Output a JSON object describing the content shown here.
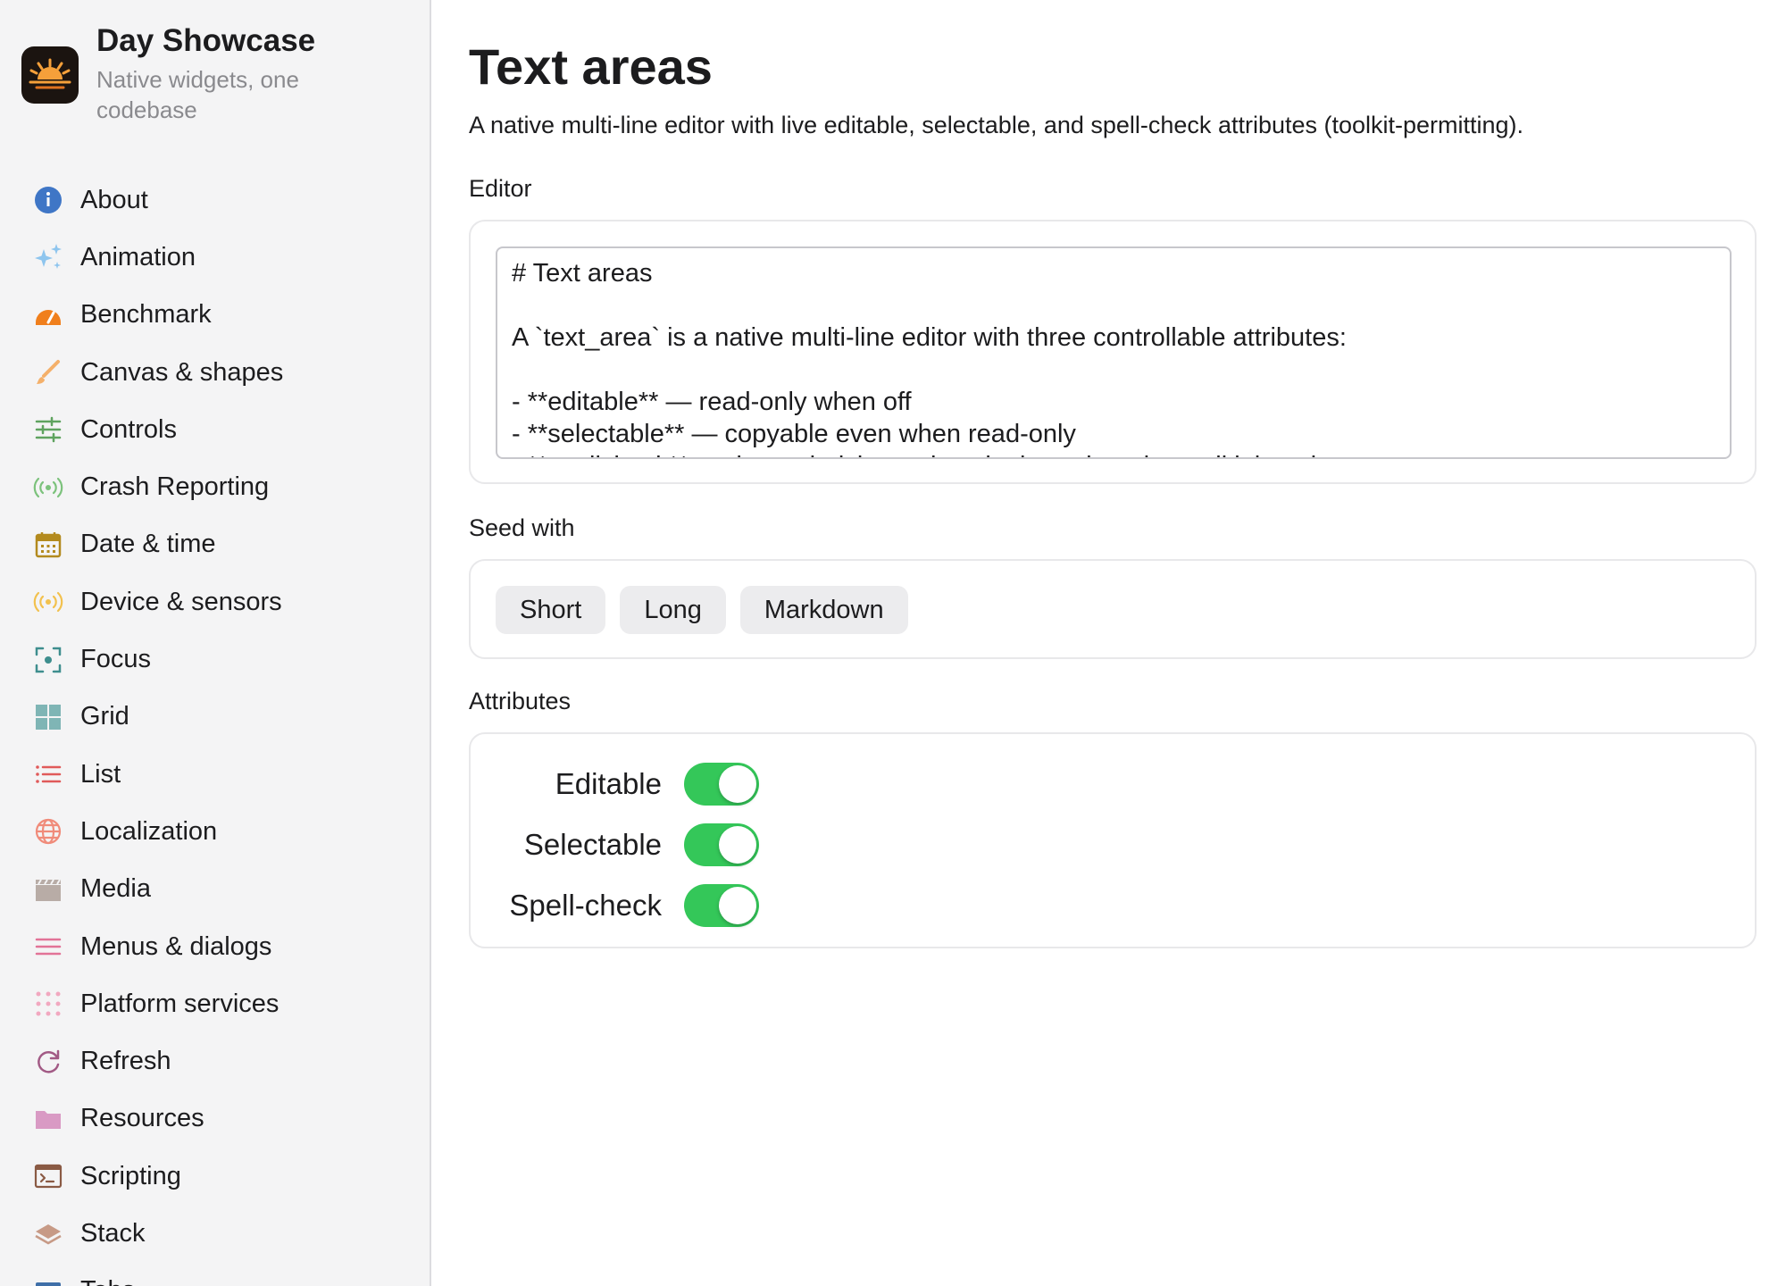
{
  "sidebar": {
    "app_title": "Day Showcase",
    "app_subtitle": "Native widgets, one codebase",
    "items": [
      {
        "label": "About",
        "icon": "info-icon",
        "color": "#3f76c6"
      },
      {
        "label": "Animation",
        "icon": "sparkles-icon",
        "color": "#8ec5ee"
      },
      {
        "label": "Benchmark",
        "icon": "gauge-icon",
        "color": "#f07f1c"
      },
      {
        "label": "Canvas & shapes",
        "icon": "brush-icon",
        "color": "#f4b06a"
      },
      {
        "label": "Controls",
        "icon": "sliders-icon",
        "color": "#5fa35f"
      },
      {
        "label": "Crash Reporting",
        "icon": "broadcast-icon",
        "color": "#7cc27c"
      },
      {
        "label": "Date & time",
        "icon": "calendar-icon",
        "color": "#b38a1e"
      },
      {
        "label": "Device & sensors",
        "icon": "broadcast-icon",
        "color": "#f2c14e"
      },
      {
        "label": "Focus",
        "icon": "focus-icon",
        "color": "#3e8e8e"
      },
      {
        "label": "Grid",
        "icon": "grid-icon",
        "color": "#7fb5b5"
      },
      {
        "label": "List",
        "icon": "list-icon",
        "color": "#e05a5a"
      },
      {
        "label": "Localization",
        "icon": "globe-icon",
        "color": "#f08b7a"
      },
      {
        "label": "Media",
        "icon": "clapper-icon",
        "color": "#b8aca6"
      },
      {
        "label": "Menus & dialogs",
        "icon": "menu-icon",
        "color": "#e27397"
      },
      {
        "label": "Platform services",
        "icon": "dots-grid-icon",
        "color": "#f2a8c0"
      },
      {
        "label": "Refresh",
        "icon": "refresh-icon",
        "color": "#a25a85"
      },
      {
        "label": "Resources",
        "icon": "folder-icon",
        "color": "#d99ac4"
      },
      {
        "label": "Scripting",
        "icon": "terminal-icon",
        "color": "#8a5a44"
      },
      {
        "label": "Stack",
        "icon": "stack-icon",
        "color": "#c79a86"
      },
      {
        "label": "Tabs",
        "icon": "tabs-icon",
        "color": "#3f6fa8"
      }
    ]
  },
  "main": {
    "title": "Text areas",
    "description": "A native multi-line editor with live editable, selectable, and spell-check attributes (toolkit-permitting).",
    "editor_label": "Editor",
    "editor_text": "# Text areas\n\nA `text_area` is a native multi-line editor with three controllable attributes:\n\n- **editable** — read-only when off\n- **selectable** — copyable even when read-only\n- **spellcheck** — the underlying red squiggles, when the toolkit has them",
    "seed_label": "Seed with",
    "seed_buttons": [
      "Short",
      "Long",
      "Markdown"
    ],
    "attributes_label": "Attributes",
    "attributes": [
      {
        "label": "Editable",
        "on": true
      },
      {
        "label": "Selectable",
        "on": true
      },
      {
        "label": "Spell-check",
        "on": true
      }
    ]
  },
  "colors": {
    "toggle_on": "#34c759",
    "sidebar_bg": "#f4f4f5"
  }
}
